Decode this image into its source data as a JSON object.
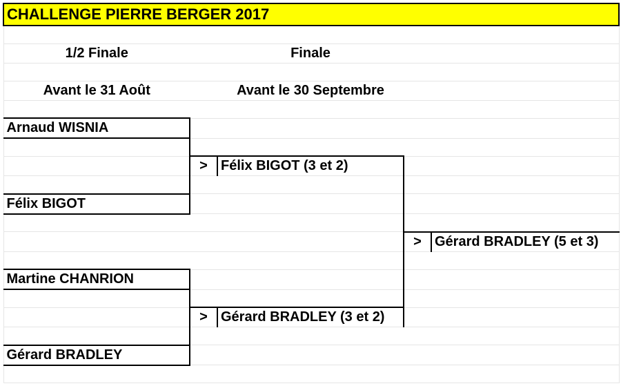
{
  "title": "CHALLENGE PIERRE BERGER 2017",
  "rounds": {
    "semifinal": {
      "label": "1/2 Finale",
      "deadline": "Avant le 31 Août"
    },
    "final": {
      "label": "Finale",
      "deadline": "Avant le 30 Septembre"
    }
  },
  "arrow": ">",
  "bracket": {
    "sf1": {
      "p1": "Arnaud WISNIA",
      "p2": "Félix BIGOT",
      "winner": "Félix BIGOT (3 et 2)"
    },
    "sf2": {
      "p1": "Martine CHANRION",
      "p2": "Gérard BRADLEY",
      "winner": "Gérard BRADLEY (3 et 2)"
    },
    "final_winner": "Gérard BRADLEY (5 et 3)"
  }
}
